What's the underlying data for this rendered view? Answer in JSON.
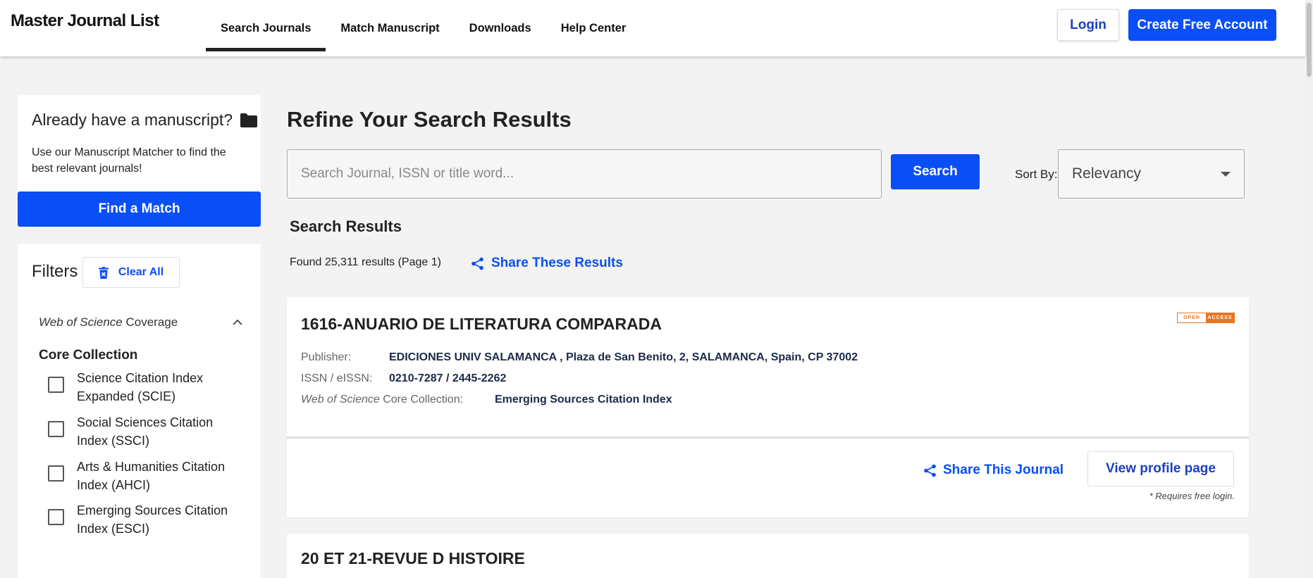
{
  "header": {
    "logo": "Master Journal List",
    "nav": [
      "Search Journals",
      "Match Manuscript",
      "Downloads",
      "Help Center"
    ],
    "login_label": "Login",
    "create_account_label": "Create Free Account"
  },
  "sidebar": {
    "manuscript_title": "Already have a manuscript?",
    "manuscript_desc": "Use our Manuscript Matcher to find the best relevant journals!",
    "find_match_label": "Find a Match",
    "filters_title": "Filters",
    "clear_all_label": "Clear All",
    "coverage_italic": "Web of Science",
    "coverage_rest": " Coverage",
    "core_collection_title": "Core Collection",
    "core_options": [
      "Science Citation Index Expanded (SCIE)",
      "Social Sciences Citation Index (SSCI)",
      "Arts & Humanities Citation Index (AHCI)",
      "Emerging Sources Citation Index (ESCI)"
    ]
  },
  "main": {
    "title": "Refine Your Search Results",
    "search_placeholder": "Search Journal, ISSN or title word...",
    "search_button": "Search",
    "sort_label": "Sort By:",
    "sort_value": "Relevancy",
    "results_title": "Search Results",
    "found_text": "Found 25,311 results (Page 1)",
    "share_results_label": "Share These Results"
  },
  "results": [
    {
      "title": "1616-ANUARIO DE LITERATURA COMPARADA",
      "oa_badge": [
        "OPEN",
        "ACCESS"
      ],
      "publisher_label": "Publisher:",
      "publisher": "EDICIONES UNIV SALAMANCA , Plaza de San Benito, 2, SALAMANCA, Spain, CP 37002",
      "issn_label": "ISSN / eISSN:",
      "issn": "0210-7287 / 2445-2262",
      "wos_label_italic": "Web of Science",
      "wos_label_rest": " Core Collection:",
      "wos_value": "Emerging Sources Citation Index",
      "share_label": "Share This Journal",
      "profile_label": "View profile page",
      "note": "* Requires free login."
    },
    {
      "title": "20 ET 21-REVUE D HISTOIRE"
    }
  ],
  "colors": {
    "accent": "#0a4ef5",
    "oa_orange": "#e87722",
    "background": "#f3f3f3"
  }
}
